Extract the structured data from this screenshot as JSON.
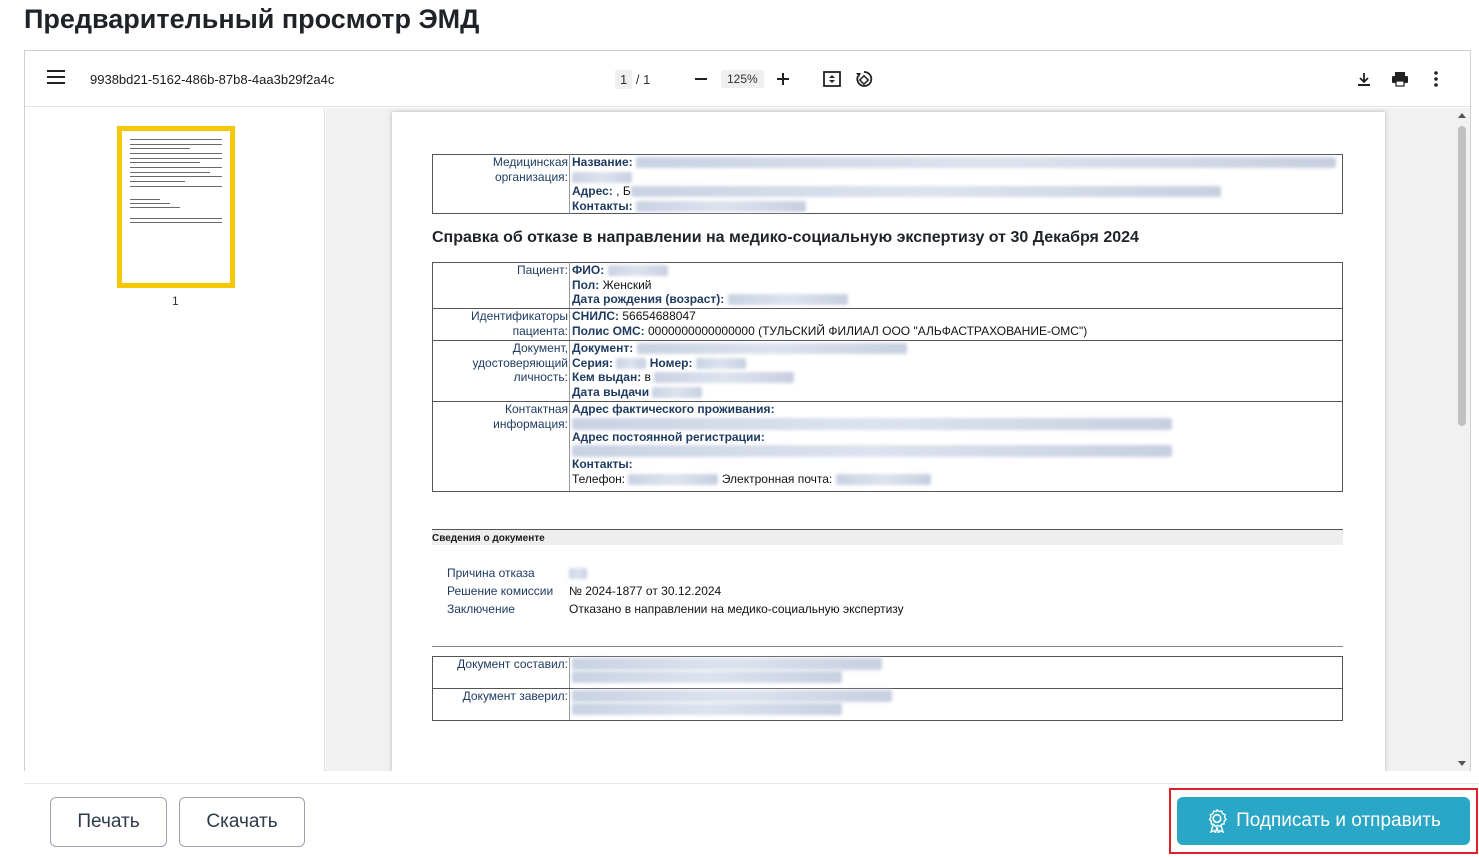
{
  "page": {
    "title": "Предварительный просмотр ЭМД"
  },
  "viewer": {
    "filename": "9938bd21-5162-486b-87b8-4aa3b29f2a4c",
    "current_page": "1",
    "page_sep": "/",
    "total_pages": "1",
    "zoom": "125%",
    "thumbnail_label": "1"
  },
  "doc": {
    "org": {
      "label": "Медицинская организация:",
      "name_key": "Название:",
      "address_key": "Адрес:",
      "address_prefix": " , Б",
      "contacts_key": "Контакты:"
    },
    "heading": "Справка об отказе в направлении на медико-социальную экспертизу от 30 Декабря 2024",
    "patient": {
      "label": "Пациент:",
      "fio_key": "ФИО:",
      "sex_key": "Пол:",
      "sex_value": " Женский",
      "dob_key": "Дата рождения (возраст):"
    },
    "ids": {
      "label": "Идентификаторы пациента:",
      "snils_key": "СНИЛС:",
      "snils_value": " 56654688047",
      "oms_key": "Полис ОМС:",
      "oms_value": " 0000000000000000 (ТУЛЬСКИЙ ФИЛИАЛ ООО \"АЛЬФАСТРАХОВАНИЕ-ОМС\")"
    },
    "identity": {
      "label": "Документ, удостоверяющий личность:",
      "doc_key": "Документ:",
      "series_key": "Серия:",
      "number_key": "Номер:",
      "issued_key": "Кем выдан:",
      "issued_prefix": " в",
      "issue_date_key": "Дата выдачи"
    },
    "contact": {
      "label": "Контактная информация:",
      "actual_addr_key": "Адрес фактического проживания:",
      "reg_addr_key": "Адрес постоянной регистрации:",
      "contacts_key": "Контакты:",
      "phone_key": "Телефон:",
      "email_key": "Электронная почта:"
    },
    "section_title": "Сведения о документе",
    "details": {
      "reason_label": "Причина отказа",
      "decision_label": "Решение комиссии",
      "decision_value": "№ 2024-1877 от 30.12.2024",
      "conclusion_label": "Заключение",
      "conclusion_value": "Отказано в направлении на медико-социальную экспертизу"
    },
    "signers": {
      "composed_label": "Документ составил:",
      "certified_label": "Документ заверил:"
    }
  },
  "actions": {
    "print_label": "Печать",
    "download_label": "Скачать",
    "sign_label": "Подписать и отправить"
  },
  "colors": {
    "accent": "#2aa6c7",
    "highlight": "#e0202a",
    "thumb_border": "#f5c800"
  }
}
